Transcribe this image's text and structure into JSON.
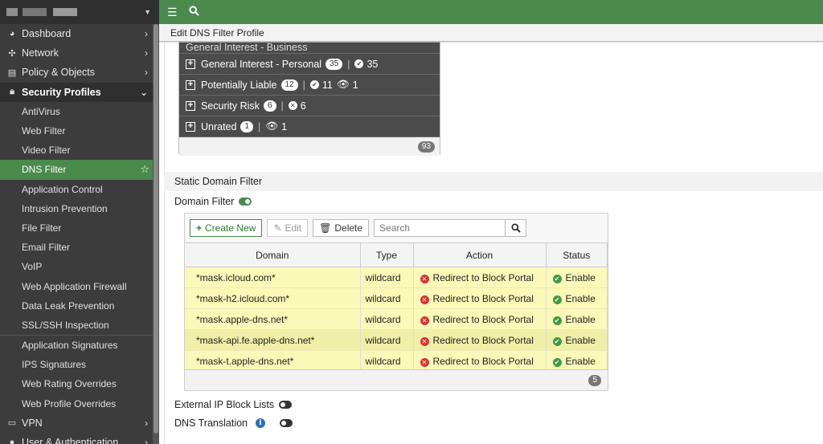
{
  "topbar": {
    "menu_icon": "hamburger-icon",
    "search_icon": "search-icon"
  },
  "title": "Edit DNS Filter Profile",
  "sidebar": {
    "items": [
      {
        "label": "Dashboard",
        "icon": "dashboard-icon"
      },
      {
        "label": "Network",
        "icon": "network-icon"
      },
      {
        "label": "Policy & Objects",
        "icon": "policy-icon"
      },
      {
        "label": "Security Profiles",
        "icon": "lock-icon"
      }
    ],
    "security_subitems": [
      "AntiVirus",
      "Web Filter",
      "Video Filter",
      "DNS Filter",
      "Application Control",
      "Intrusion Prevention",
      "File Filter",
      "Email Filter",
      "VoIP",
      "Web Application Firewall",
      "Data Leak Prevention",
      "SSL/SSH Inspection"
    ],
    "security_subitems_2": [
      "Application Signatures",
      "IPS Signatures",
      "Web Rating Overrides",
      "Web Profile Overrides"
    ],
    "bottom_items": [
      {
        "label": "VPN",
        "icon": "laptop-icon"
      },
      {
        "label": "User & Authentication",
        "icon": "user-icon"
      }
    ],
    "active": "DNS Filter"
  },
  "categories": {
    "partial_row": {
      "label": "General Interest - Business"
    },
    "rows": [
      {
        "label": "General Interest - Personal",
        "count": "35",
        "summary": [
          {
            "icon": "check",
            "value": "35"
          }
        ]
      },
      {
        "label": "Potentially Liable",
        "count": "12",
        "summary": [
          {
            "icon": "check",
            "value": "11"
          },
          {
            "icon": "eye",
            "value": "1"
          }
        ]
      },
      {
        "label": "Security Risk",
        "count": "6",
        "summary": [
          {
            "icon": "x",
            "value": "6"
          }
        ]
      },
      {
        "label": "Unrated",
        "count": "1",
        "summary": [
          {
            "icon": "eye",
            "value": "1"
          }
        ]
      }
    ],
    "total": "93"
  },
  "static_domain_filter": {
    "header": "Static Domain Filter",
    "domain_filter_label": "Domain Filter",
    "domain_filter_enabled": true,
    "toolbar": {
      "create_label": "Create New",
      "edit_label": "Edit",
      "delete_label": "Delete",
      "search_placeholder": "Search"
    },
    "columns": [
      "Domain",
      "Type",
      "Action",
      "Status"
    ],
    "rows": [
      {
        "domain": "*mask.icloud.com*",
        "type": "wildcard",
        "action": "Redirect to Block Portal",
        "status": "Enable"
      },
      {
        "domain": "*mask-h2.icloud.com*",
        "type": "wildcard",
        "action": "Redirect to Block Portal",
        "status": "Enable"
      },
      {
        "domain": "*mask.apple-dns.net*",
        "type": "wildcard",
        "action": "Redirect to Block Portal",
        "status": "Enable"
      },
      {
        "domain": "*mask-api.fe.apple-dns.net*",
        "type": "wildcard",
        "action": "Redirect to Block Portal",
        "status": "Enable"
      },
      {
        "domain": "*mask-t.apple-dns.net*",
        "type": "wildcard",
        "action": "Redirect to Block Portal",
        "status": "Enable"
      }
    ],
    "total": "5"
  },
  "external_ip_label": "External IP Block Lists",
  "external_ip_enabled": false,
  "dns_translation_label": "DNS Translation",
  "dns_translation_enabled": false,
  "colors": {
    "accent": "#4a8a4d",
    "sidebar": "#3c3c3c",
    "row_highlight": "#fbf9b7"
  }
}
